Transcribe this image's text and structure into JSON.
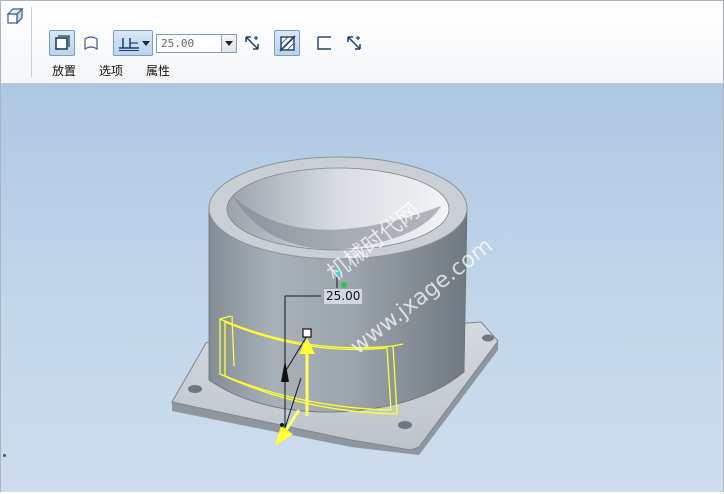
{
  "dashboard": {
    "depth_value": "25.00",
    "tabs": [
      {
        "label": "放置"
      },
      {
        "label": "选项"
      },
      {
        "label": "属性"
      }
    ],
    "icons": {
      "feature": "extrude-feature-icon",
      "solid": "solid-icon",
      "surface": "surface-icon",
      "depth_option": "blind-depth-icon",
      "flip_depth": "flip-direction-icon",
      "remove_material": "remove-material-icon",
      "thicken": "thicken-icon",
      "flip_thicken": "flip-thicken-icon"
    },
    "active_color": "#b9d4ee"
  },
  "viewport": {
    "dimension_label": "25.00",
    "watermark_cn": "机械时代网",
    "watermark_url": "www.jxage.com",
    "colors": {
      "background_top": "#aec8e3",
      "model": "#a3abb3",
      "preview_highlight": "#ffff33",
      "drag_handle": "#111111"
    }
  }
}
